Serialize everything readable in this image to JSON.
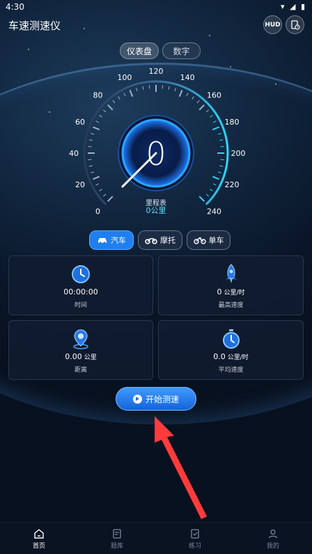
{
  "status_bar": {
    "time": "4:30",
    "icons": [
      "wifi-icon",
      "signal-icon",
      "battery-icon"
    ]
  },
  "header": {
    "title": "车速测速仪",
    "hud_label": "HUD",
    "history_icon": "history-icon"
  },
  "mode_tabs": [
    {
      "label": "仪表盘",
      "active": true
    },
    {
      "label": "数字",
      "active": false
    }
  ],
  "gauge": {
    "speed": "0",
    "odometer_label": "里程表",
    "odometer_value": "0公里",
    "ticks": [
      "0",
      "20",
      "40",
      "60",
      "80",
      "100",
      "120",
      "140",
      "160",
      "180",
      "200",
      "220",
      "240"
    ],
    "min": 0,
    "max": 240,
    "needle_value": 0,
    "accent_color": "#2ad8ff"
  },
  "vehicle_tabs": [
    {
      "label": "汽车",
      "icon": "car-icon",
      "active": true
    },
    {
      "label": "摩托",
      "icon": "motorcycle-icon",
      "active": false
    },
    {
      "label": "单车",
      "icon": "bicycle-icon",
      "active": false
    }
  ],
  "stats": {
    "time": {
      "value": "00:00:00",
      "label": "时间",
      "icon": "clock-icon"
    },
    "max_speed": {
      "value": "0",
      "unit": "公里/时",
      "label": "最高速度",
      "icon": "rocket-icon"
    },
    "distance": {
      "value": "0.00",
      "unit": "公里",
      "label": "距离",
      "icon": "location-pin-icon"
    },
    "avg_speed": {
      "value": "0.0",
      "unit": "公里/时",
      "label": "平均速度",
      "icon": "stopwatch-icon"
    }
  },
  "start_button": {
    "label": "开始测速",
    "icon": "play-icon"
  },
  "bottom_nav": [
    {
      "label": "首页",
      "icon": "home-icon",
      "active": true
    },
    {
      "label": "题库",
      "icon": "question-bank-icon",
      "active": false
    },
    {
      "label": "练习",
      "icon": "practice-icon",
      "active": false
    },
    {
      "label": "我的",
      "icon": "profile-icon",
      "active": false
    }
  ],
  "colors": {
    "background": "#0b1526",
    "accent": "#1f7ff0",
    "gauge_accent": "#2ad8ff",
    "annotation_arrow": "#ff3b3b"
  }
}
